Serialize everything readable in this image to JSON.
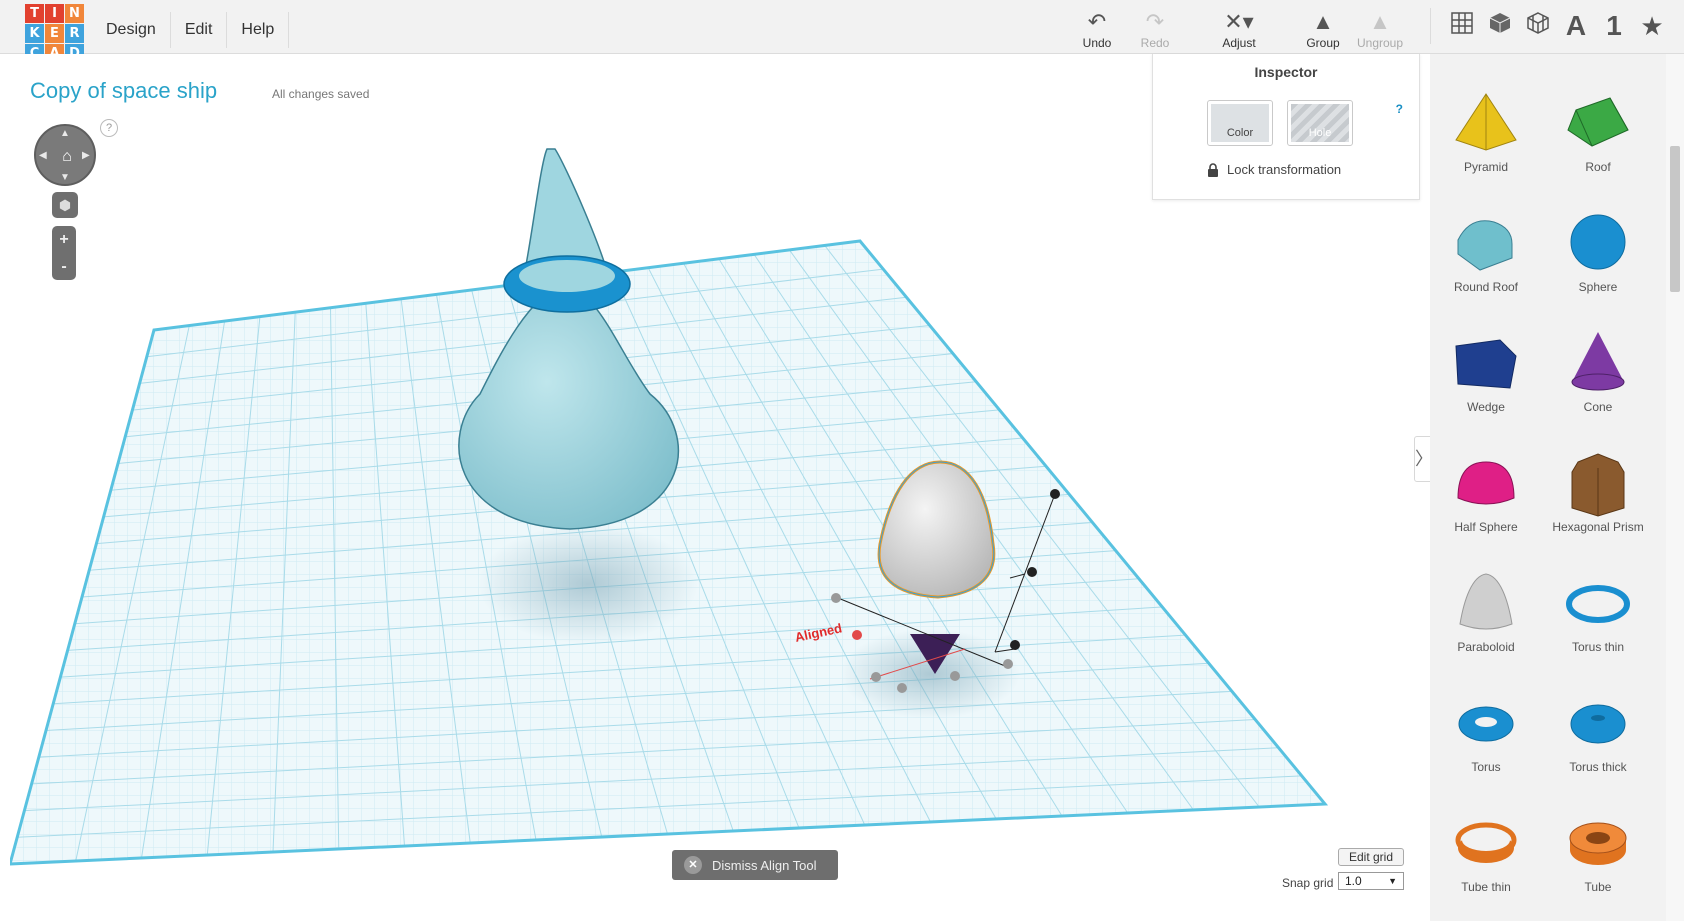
{
  "app": {
    "logo_letters": [
      "T",
      "I",
      "N",
      "K",
      "E",
      "R",
      "C",
      "A",
      "D"
    ],
    "logo_colors": [
      "#e2412f",
      "#e2412f",
      "#f1863a",
      "#3fa3dd",
      "#f1863a",
      "#3fa3dd",
      "#3fa3dd",
      "#f1863a",
      "#3fa3dd"
    ]
  },
  "menu": {
    "design": "Design",
    "edit": "Edit",
    "help": "Help"
  },
  "toolbar": {
    "undo": "Undo",
    "redo": "Redo",
    "adjust": "Adjust",
    "group": "Group",
    "ungroup": "Ungroup"
  },
  "view_tools": {
    "text_tool": "A",
    "number_tool": "1",
    "star_tool": "★"
  },
  "workspace": {
    "design_title": "Copy of space ship",
    "save_status": "All changes saved",
    "nav_help": "?",
    "align_label": "Aligned",
    "zoom_in": "+",
    "zoom_out": "-"
  },
  "inspector": {
    "title": "Inspector",
    "help": "?",
    "color_label": "Color",
    "hole_label": "Hole",
    "lock_label": "Lock transformation"
  },
  "bottom": {
    "dismiss_label": "Dismiss Align Tool",
    "edit_grid_label": "Edit grid",
    "snap_grid_label": "Snap grid",
    "snap_grid_value": "1.0"
  },
  "shapes": [
    {
      "label": "Pyramid",
      "icon": "pyramid-icon",
      "color": "#e8c21b"
    },
    {
      "label": "Roof",
      "icon": "roof-icon",
      "color": "#3ba945"
    },
    {
      "label": "Round Roof",
      "icon": "round-roof-icon",
      "color": "#6fbfcc"
    },
    {
      "label": "Sphere",
      "icon": "sphere-icon",
      "color": "#1a8fd0"
    },
    {
      "label": "Wedge",
      "icon": "wedge-icon",
      "color": "#1f3f8f"
    },
    {
      "label": "Cone",
      "icon": "cone-icon",
      "color": "#7d3aa3"
    },
    {
      "label": "Half Sphere",
      "icon": "half-sphere-icon",
      "color": "#df1f86"
    },
    {
      "label": "Hexagonal Prism",
      "icon": "hexagonal-prism-icon",
      "color": "#8a5a2e"
    },
    {
      "label": "Paraboloid",
      "icon": "paraboloid-icon",
      "color": "#cfcfcf"
    },
    {
      "label": "Torus thin",
      "icon": "torus-thin-icon",
      "color": "#1a8fd0"
    },
    {
      "label": "Torus",
      "icon": "torus-icon",
      "color": "#1a8fd0"
    },
    {
      "label": "Torus thick",
      "icon": "torus-thick-icon",
      "color": "#1a8fd0"
    },
    {
      "label": "Tube thin",
      "icon": "tube-thin-icon",
      "color": "#e0731f"
    },
    {
      "label": "Tube",
      "icon": "tube-icon",
      "color": "#e0731f"
    }
  ]
}
